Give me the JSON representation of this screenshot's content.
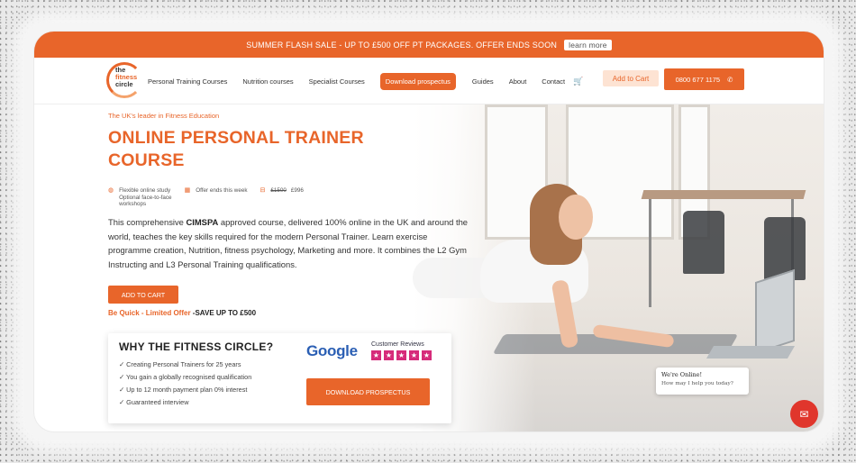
{
  "promo": {
    "text": "SUMMER FLASH SALE - UP TO £500 OFF PT PACKAGES. OFFER ENDS SOON",
    "link": "learn more"
  },
  "logo": {
    "line1": "the",
    "line2": "fitness",
    "line3": "circle"
  },
  "nav": {
    "items": [
      "Personal Training Courses",
      "Nutrition courses",
      "Specialist Courses"
    ],
    "download": "Download prospectus",
    "items2": [
      "Guides",
      "About",
      "Contact"
    ],
    "cart_icon": "cart-icon",
    "add_to_cart": "Add to Cart",
    "phone": "0800 677 1175",
    "phone_icon": "phone-icon"
  },
  "hero": {
    "tagline": "The UK's leader in Fitness Education",
    "title": "ONLINE PERSONAL TRAINER COURSE",
    "features": {
      "study_line1": "Flexible online study",
      "study_line2": "Optional face-to-face",
      "study_line3": "workshops",
      "offer": "Offer ends this week",
      "old_price": "£1500",
      "new_price": "£996"
    },
    "desc_pre": "This comprehensive ",
    "desc_bold": "CIMSPA",
    "desc_post": " approved course, delivered 100% online in the UK and around the world, teaches the key skills required for the modern Personal Trainer. Learn exercise programme creation, Nutrition, fitness psychology, Marketing and more. It combines the L2 Gym Instructing and L3 Personal Training qualifications.",
    "add_to_cart": "ADD TO CART",
    "quick_a": "Be Quick - Limited Offer ",
    "quick_b": "-SAVE UP TO £500"
  },
  "why": {
    "title": "WHY THE FITNESS CIRCLE?",
    "points": [
      "✓ Creating Personal Trainers for 25 years",
      "✓ You gain a globally recognised qualification",
      "✓ Up to 12 month payment plan 0% interest",
      "✓ Guaranteed interview"
    ],
    "google": "Google",
    "reviews_label": "Customer Reviews",
    "stars": 5,
    "download": "DOWNLOAD PROSPECTUS"
  },
  "chat": {
    "title": "We're Online!",
    "sub": "How may I help you today?"
  },
  "colors": {
    "accent": "#e8652a",
    "star": "#d62b7a",
    "chat": "#e0362c"
  }
}
